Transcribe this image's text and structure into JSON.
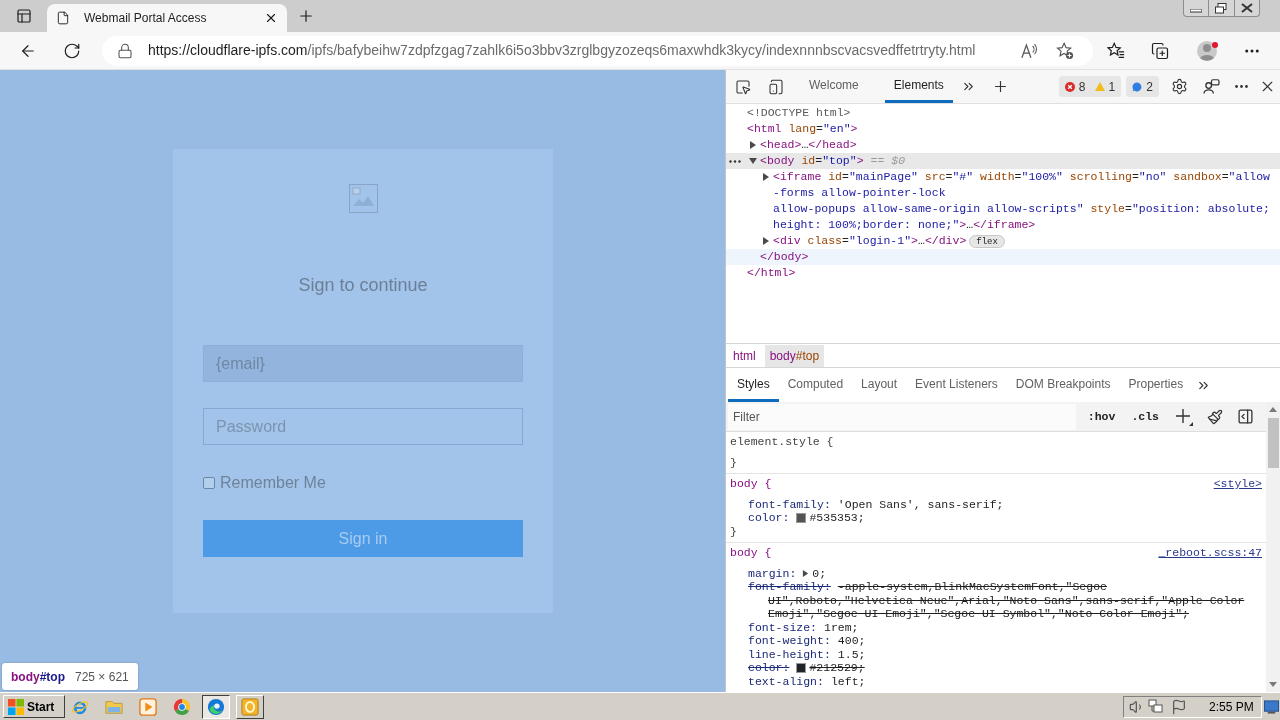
{
  "browser": {
    "tab": {
      "title": "Webmail Portal Access",
      "selected": true
    },
    "address": {
      "host": "https://cloudflare-ipfs.com",
      "path": "/ipfs/bafybeihw7zdpfzgag7zahlk6i5o3bbv3zrglbgyzozeqs6maxwhdk3kycy/indexnnnbscvacsvedffetrtryty.html"
    }
  },
  "page": {
    "heading": "Sign to continue",
    "fields": [
      {
        "kind": "email",
        "value": "{email}"
      },
      {
        "kind": "password",
        "placeholder": "Password"
      }
    ],
    "remember": {
      "label": "Remember Me",
      "checked": false
    },
    "submit": "Sign in"
  },
  "inspect_tooltip": {
    "selector": "body#top",
    "size": "725 × 621"
  },
  "devtools": {
    "tabs": [
      {
        "label": "Welcome",
        "selected": false
      },
      {
        "label": "Elements",
        "selected": true
      }
    ],
    "issue_badges": [
      {
        "items": [
          {
            "kind": "error",
            "count": "8"
          },
          {
            "kind": "warning",
            "count": "1"
          }
        ]
      },
      {
        "items": [
          {
            "kind": "info",
            "count": "2"
          }
        ]
      }
    ],
    "dom": [
      {
        "kind": "doctype",
        "lines": [
          "<!DOCTYPE html>"
        ],
        "selected": false
      },
      {
        "kind": "element",
        "lines": [
          "<html lang=\"en\">"
        ],
        "selected": false,
        "children": [
          {
            "kind": "element",
            "lines": [
              "<head>…</head>"
            ],
            "expanded": false,
            "selected": false
          },
          {
            "kind": "element",
            "lines": [
              "<body id=\"top\">"
            ],
            "suffix": "== $0",
            "expanded": true,
            "selected": true,
            "children": [
              {
                "kind": "element",
                "lines": [
                  "<iframe id=\"mainPage\" src=\"#\" width=\"100%\" scrolling=\"no\" sandbox=\"allow",
                  "-forms allow-pointer-lock",
                  "allow-popups allow-same-origin allow-scripts\" style=\"position: absolute;",
                  "height: 100%;border: none;\">…</iframe>"
                ],
                "expanded": false,
                "selected": false
              },
              {
                "kind": "element",
                "lines": [
                  "<div class=\"login-1\">…</div>"
                ],
                "badge": "flex",
                "expanded": false,
                "selected": false
              }
            ],
            "close": "</body>"
          }
        ],
        "close": "</html>"
      }
    ],
    "breadcrumbs": [
      {
        "label": "html",
        "selected": false
      },
      {
        "label": "body#top",
        "selected": true
      }
    ],
    "panel_tabs": [
      {
        "label": "Styles",
        "selected": true
      },
      {
        "label": "Computed",
        "selected": false
      },
      {
        "label": "Layout",
        "selected": false
      },
      {
        "label": "Event Listeners",
        "selected": false
      },
      {
        "label": "DOM Breakpoints",
        "selected": false
      },
      {
        "label": "Properties",
        "selected": false
      }
    ],
    "filter": {
      "placeholder": "Filter"
    },
    "state_toggles": [
      ":hov",
      ".cls"
    ],
    "rules": [
      {
        "kind": "inline",
        "selector": "element.style {",
        "close": "}"
      },
      {
        "kind": "rule",
        "selector": "body {",
        "source": "<style>",
        "declarations": [
          {
            "property": "font-family:",
            "value": "'Open Sans', sans-serif;"
          },
          {
            "property": "color:",
            "color": "#535353",
            "value": "#535353;"
          }
        ],
        "close": "}"
      },
      {
        "kind": "rule",
        "selector": "body {",
        "source": "_reboot.scss:47",
        "declarations": [
          {
            "property": "margin:",
            "expanded": false,
            "value": "0;"
          },
          {
            "property": "font-family:",
            "overridden": true,
            "value_lines": [
              "-apple-system,BlinkMacSystemFont,\"Segoe",
              "UI\",Roboto,\"Helvetica Neue\",Arial,\"Noto Sans\",sans-serif,\"Apple Color",
              "Emoji\",\"Segoe UI Emoji\",\"Segoe UI Symbol\",\"Noto Color Emoji\";"
            ]
          },
          {
            "property": "font-size:",
            "value": "1rem;"
          },
          {
            "property": "font-weight:",
            "value": "400;"
          },
          {
            "property": "line-height:",
            "value": "1.5;"
          },
          {
            "property": "color:",
            "color": "#212529",
            "overridden": true,
            "value": "#212529;"
          },
          {
            "property": "text-align:",
            "value": "left;"
          }
        ]
      }
    ]
  },
  "taskbar": {
    "start": "Start",
    "apps": [
      {
        "kind": "ie",
        "open": false,
        "selected": false
      },
      {
        "kind": "explorer",
        "open": false,
        "selected": false
      },
      {
        "kind": "media",
        "open": false,
        "selected": false
      },
      {
        "kind": "chrome",
        "open": false,
        "selected": false
      },
      {
        "kind": "edge",
        "open": true,
        "selected": true
      },
      {
        "kind": "app",
        "open": true,
        "selected": false
      }
    ],
    "clock": "2:55 PM"
  }
}
